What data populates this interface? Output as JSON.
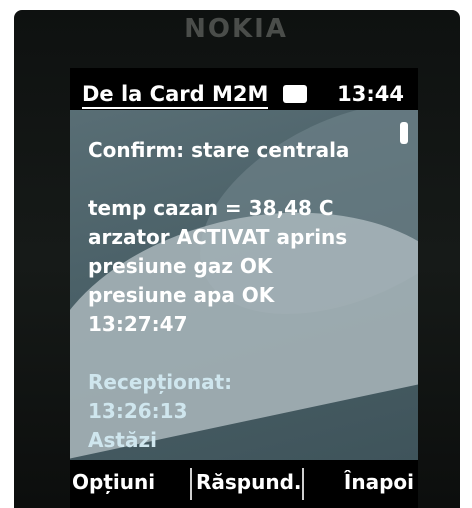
{
  "device": {
    "brand": "NOKIA"
  },
  "statusbar": {
    "title": "De la Card M2M",
    "time": "13:44",
    "icon": "message-icon"
  },
  "message": {
    "lines": [
      "Confirm: stare centrala",
      "",
      "temp cazan = 38,48 C",
      "arzator ACTIVAT aprins",
      "presiune gaz OK",
      "presiune apa OK",
      "13:27:47"
    ],
    "received_label": "Recepționat:",
    "received_time": "13:26:13",
    "received_day": "Astăzi"
  },
  "softkeys": {
    "left": "Opțiuni",
    "middle": "Răspund.",
    "right": "Înapoi"
  },
  "colors": {
    "background": "#4b6168",
    "text": "#ffffff",
    "meta": "#cfe6ee",
    "bar": "#000000"
  }
}
